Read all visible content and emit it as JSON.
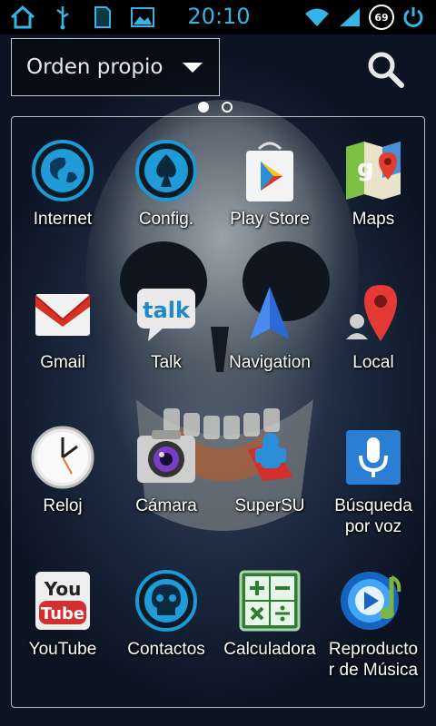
{
  "status_bar": {
    "time": "20:10",
    "battery_level": "69",
    "icons": [
      "home-icon",
      "usb-icon",
      "sd-card-icon",
      "gallery-icon",
      "wifi-icon",
      "signal-icon",
      "battery-icon",
      "power-icon"
    ]
  },
  "toolbar": {
    "sort_label": "Orden propio",
    "search_icon": "search-icon"
  },
  "pager": {
    "pages": 2,
    "current": 1
  },
  "apps": [
    {
      "label": "Internet",
      "icon": "globe-icon"
    },
    {
      "label": "Config.",
      "icon": "settings-spade-icon"
    },
    {
      "label": "Play Store",
      "icon": "play-store-icon"
    },
    {
      "label": "Maps",
      "icon": "maps-icon"
    },
    {
      "label": "Gmail",
      "icon": "gmail-icon"
    },
    {
      "label": "Talk",
      "icon": "talk-icon"
    },
    {
      "label": "Navigation",
      "icon": "navigation-icon"
    },
    {
      "label": "Local",
      "icon": "local-pin-icon"
    },
    {
      "label": "Reloj",
      "icon": "clock-icon"
    },
    {
      "label": "Cámara",
      "icon": "camera-icon"
    },
    {
      "label": "SuperSU",
      "icon": "supersu-icon"
    },
    {
      "label": "Búsqueda\npor voz",
      "icon": "microphone-icon"
    },
    {
      "label": "YouTube",
      "icon": "youtube-icon"
    },
    {
      "label": "Contactos",
      "icon": "contacts-skull-icon"
    },
    {
      "label": "Calculadora",
      "icon": "calculator-icon"
    },
    {
      "label": "Reproducto\nr de Música",
      "icon": "music-player-icon"
    }
  ],
  "colors": {
    "accent": "#33b5e5",
    "status_bar_bg": "#000000"
  }
}
